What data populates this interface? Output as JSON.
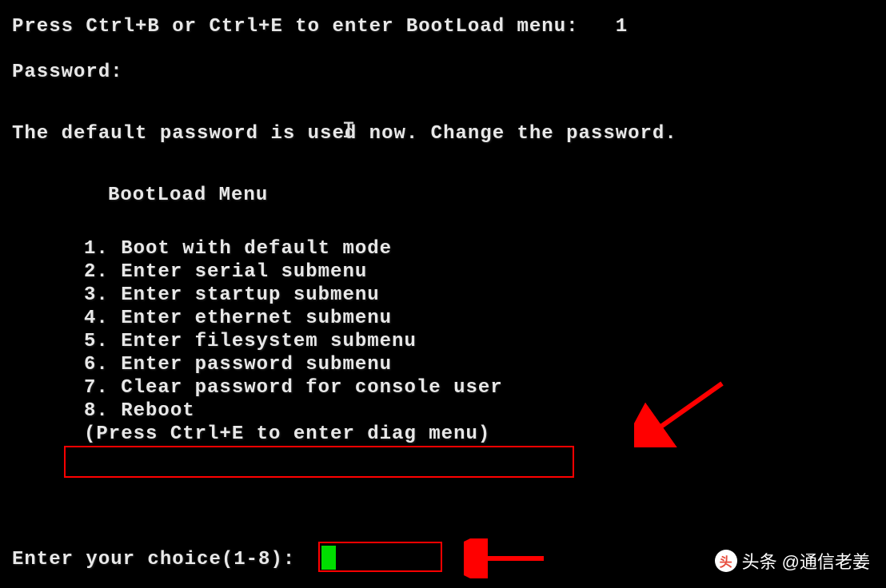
{
  "prompt": {
    "bootload_prompt": "Press Ctrl+B or Ctrl+E to enter BootLoad menu:   1",
    "password_label": "Password:",
    "default_pw_msg": "The default password is used now. Change the password."
  },
  "menu": {
    "title": "BootLoad Menu",
    "items": [
      "1. Boot with default mode",
      "2. Enter serial submenu",
      "3. Enter startup submenu",
      "4. Enter ethernet submenu",
      "5. Enter filesystem submenu",
      "6. Enter password submenu",
      "7. Clear password for console user",
      "8. Reboot"
    ],
    "hint": "(Press Ctrl+E to enter diag menu)"
  },
  "choice_prompt": "Enter your choice(1-8):",
  "watermark": {
    "prefix": "头条",
    "handle": "@通信老姜"
  }
}
